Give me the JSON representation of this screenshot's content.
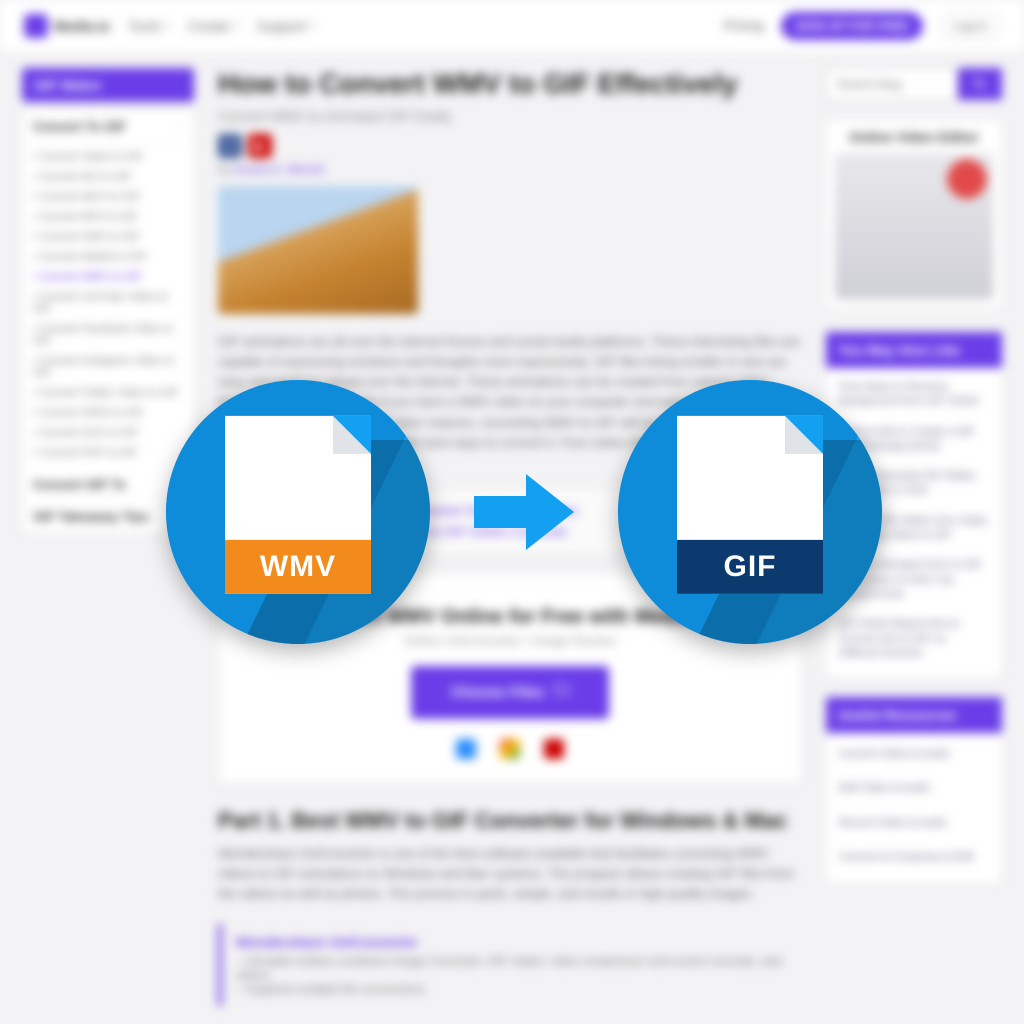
{
  "header": {
    "brand": "Media.io",
    "nav": [
      "Tools",
      "Create",
      "Support"
    ],
    "pricing": "Pricing",
    "signup": "SIGN UP FOR FREE",
    "login": "Log In"
  },
  "sidebar": {
    "title": "GIF Maker",
    "group_heading": "Convert To GIF",
    "items": [
      "Convert Video to GIF",
      "Convert AVI to GIF",
      "Convert MOV to GIF",
      "Convert MP4 to GIF",
      "Convert SWF to GIF",
      "Convert WebM to GIF",
      "Convert WMV to GIF",
      "Convert YouTube Video to GIF",
      "Convert Facebook Video to GIF",
      "Convert Instagram Video to GIF",
      "Convert Twitter Video to GIF",
      "Convert JPEG to GIF",
      "Convert SVG to GIF",
      "Convert PDF to GIF"
    ],
    "group2": "Convert GIF To",
    "group3": "GIF Takeaway Tips"
  },
  "article": {
    "title": "How to Convert WMV to GIF Effectively",
    "subtitle": "Convert WMV to Animated GIF Easily",
    "byline_prefix": "By ",
    "byline_author": "Kendra D. Mitchell",
    "body1": "GIF animations are all over the internet forums and social media platforms. These interesting files are capable of expressing emotions and thoughts more expressively. GIF files being smaller in size are easy and quick to upload over the internet. These animations can be created from various video formats, including WMV. So if you have a WMV video on your computer and want to convert WMV to GIF for sharing over Twitter or other reasons, converting WMV to GIF will be a optional way for you. In this tutorial, we will show you the best ways to convert it. Free online WMV to GIF converters are listed below.",
    "toc": [
      "Part 1. Best WMV to GIF Converter for Windows & Mac",
      "Part 2. How to Convert WMV to GIF Online Converter"
    ],
    "tool_heading": "Convert WMV Online for Free with Media.io",
    "tool_sub": "Online UniConverter • Image Resizer",
    "choose": "Choose Files",
    "part1_heading": "Part 1. Best WMV to GIF Converter for Windows & Mac",
    "part1_body": "Wondershare UniConverter is one of the best software available that facilitates converting WMV videos to GIF animations on Windows and Mac systems. The program allows creating GIF files from the videos as well as photos. The process is quick, simple, and results in high-quality images.",
    "pitch_title": "Wondershare UniConverter",
    "pitch_line1": "– Versatile toolbox combines Image Converter, GIF maker, video compressor and screen recorder, and others.",
    "pitch_line2": "– Supports multiple file conversions"
  },
  "right": {
    "search_placeholder": "Search blog",
    "promo_title": "Online Video Editor",
    "also_heading": "You May Also Like",
    "also": [
      "Free Ways to Remove Background from GIF Online",
      "How to Add or Create a GIF for WhatsApp [2022]",
      "Top 10 Animated GIF Maker and Editor in 2022",
      "10 Best GIF Maker from Video – Change Video to GIF",
      "6 Easy Animated SVG to GIF Converters of 2022 You Should Know",
      "[10 Useful Ways] How to Convert AVI to GIF on Different Devices"
    ],
    "resources_heading": "Useful Resources",
    "resources": [
      "Convert Video & Audio",
      "Edit Video & Audio",
      "Record Video & Audio",
      "Convert & Compress & Edit"
    ]
  },
  "overlay": {
    "from": "WMV",
    "to": "GIF"
  }
}
